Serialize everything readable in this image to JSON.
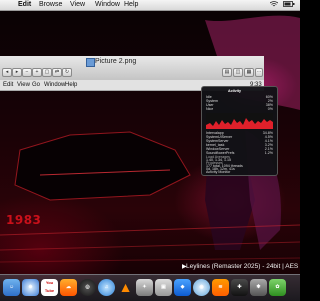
{
  "menubar": {
    "apple_icon": "apple-icon",
    "items": [
      "Edit",
      "Browse",
      "View",
      "Window",
      "Help"
    ],
    "status_icons": [
      "wifi-icon",
      "battery-icon"
    ]
  },
  "window": {
    "title": "Picture 2.png",
    "file_icon": "image-file-icon",
    "menu_items": [
      "Edit",
      "View",
      "Go",
      "Window",
      "Help"
    ],
    "clock_text": "9:33"
  },
  "popup": {
    "heading": "Activity",
    "table_rows": [
      [
        "Idle",
        "60%"
      ],
      [
        "System",
        "2%"
      ],
      [
        "User",
        "38%"
      ],
      [
        "Nice",
        "0%"
      ]
    ],
    "process_rows": [
      [
        "Intervalapp",
        "34.8%"
      ],
      [
        "SystemUIServer",
        "4.5%"
      ],
      [
        "SystemServer",
        "4.1%"
      ],
      [
        "kernel_task",
        "3.2%"
      ],
      [
        "WindowServer",
        "2.1%"
      ],
      [
        "SoundflowerPrefs",
        "1.2%"
      ]
    ],
    "load_label": "Load Averages",
    "load_value": "1.40, 1.34, 1.15",
    "processes_label": "Processes",
    "processes_value": "177 total, 1094 threads",
    "uptime_label": "Uptime",
    "uptime_value": "0d, 18h, 12m, 41s",
    "running_label": "Running Time",
    "running_value": "0d, 0h, 15m, 15s",
    "footer_link": "Activity Monitor",
    "graph_color": "#e0202a"
  },
  "wallpaper": {
    "year_text": "1983"
  },
  "now_playing": {
    "play_icon": "play-icon",
    "text": "Leylines (Remaster 2025) - 24bit | AES"
  },
  "dock": {
    "items": [
      {
        "icon": "finder-icon",
        "label": ""
      },
      {
        "icon": "safari-icon",
        "label": ""
      },
      {
        "icon": "youtube-icon",
        "label": "You Tube"
      },
      {
        "icon": "soundcloud-icon",
        "label": ""
      },
      {
        "icon": "steam-icon",
        "label": ""
      },
      {
        "icon": "itunes-icon",
        "label": ""
      },
      {
        "icon": "vlc-icon",
        "label": ""
      },
      {
        "icon": "app-icon",
        "label": ""
      },
      {
        "icon": "preview-icon",
        "label": ""
      },
      {
        "icon": "app-icon",
        "label": ""
      },
      {
        "icon": "wifi-icon",
        "label": ""
      },
      {
        "icon": "app-icon",
        "label": ""
      },
      {
        "icon": "app-icon",
        "label": ""
      },
      {
        "icon": "app-icon",
        "label": ""
      },
      {
        "icon": "app-icon",
        "label": ""
      }
    ]
  }
}
